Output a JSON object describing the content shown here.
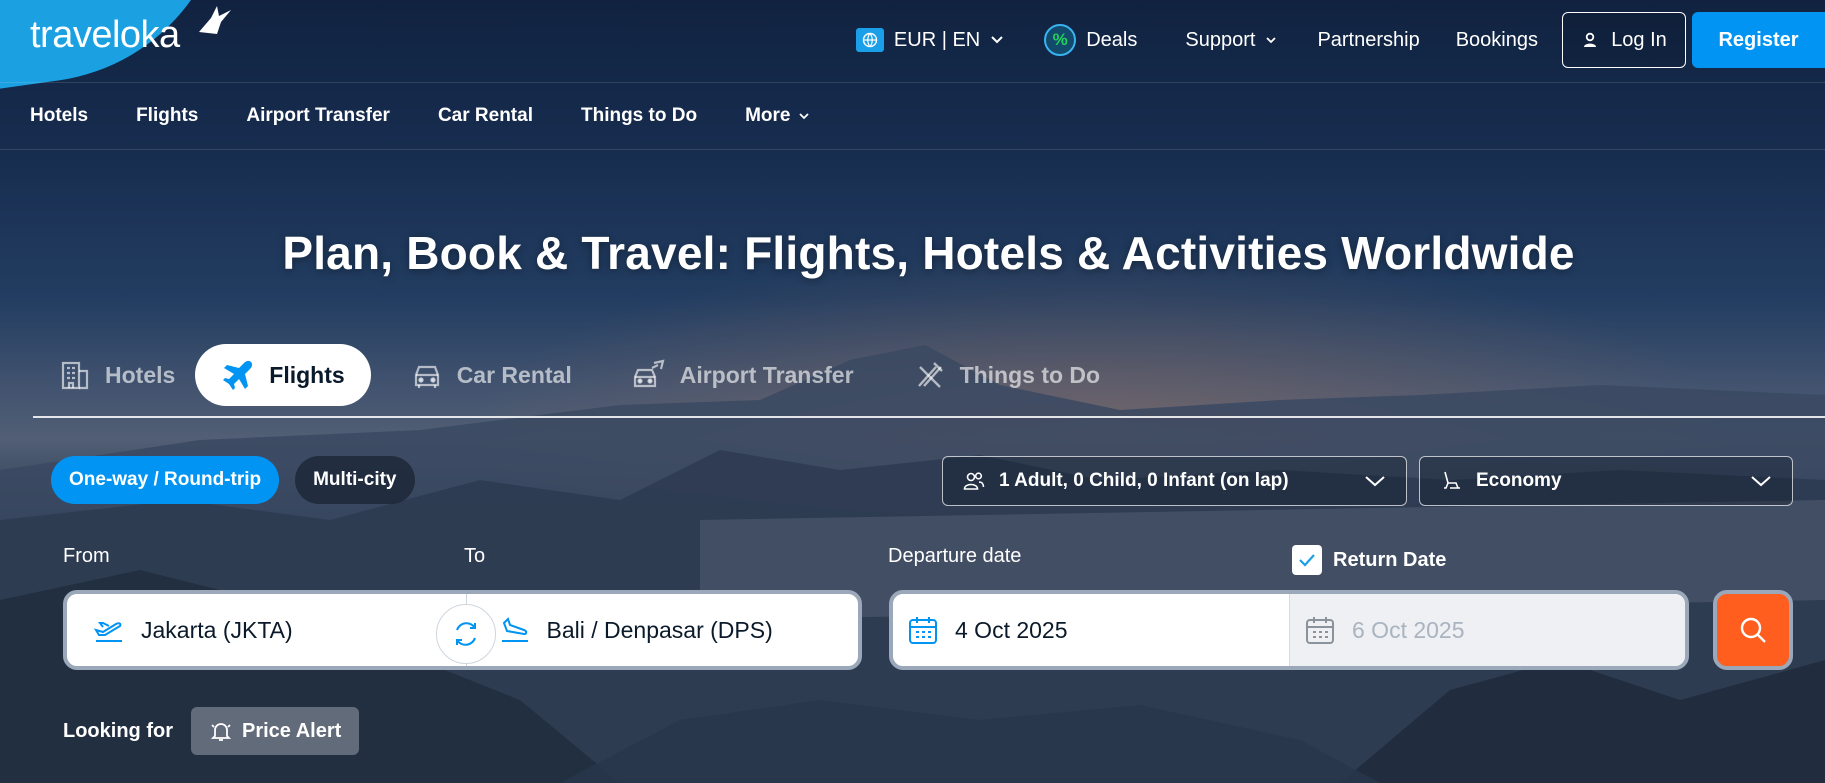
{
  "brand": {
    "name": "traveloka"
  },
  "top_nav": {
    "currency_lang": "EUR | EN",
    "deals": "Deals",
    "deals_badge": "%",
    "support": "Support",
    "partnership": "Partnership",
    "bookings": "Bookings",
    "login": "Log In",
    "register": "Register"
  },
  "second_nav": {
    "items": [
      "Hotels",
      "Flights",
      "Airport Transfer",
      "Car Rental",
      "Things to Do"
    ],
    "more": "More"
  },
  "hero": {
    "title": "Plan, Book & Travel: Flights, Hotels & Activities Worldwide"
  },
  "product_tabs": [
    {
      "label": "Hotels",
      "icon": "hotel-icon",
      "active": false
    },
    {
      "label": "Flights",
      "icon": "airplane-icon",
      "active": true
    },
    {
      "label": "Car Rental",
      "icon": "car-icon",
      "active": false
    },
    {
      "label": "Airport Transfer",
      "icon": "airport-transfer-icon",
      "active": false
    },
    {
      "label": "Things to Do",
      "icon": "things-to-do-icon",
      "active": false
    }
  ],
  "trip_type": {
    "oneway_roundtrip": "One-way / Round-trip",
    "multicity": "Multi-city"
  },
  "passengers": "1 Adult, 0 Child, 0 Infant (on lap)",
  "cabin_class": "Economy",
  "form": {
    "from_label": "From",
    "to_label": "To",
    "departure_label": "Departure date",
    "return_label": "Return Date",
    "return_checked": true,
    "from_value": "Jakarta (JKTA)",
    "to_value": "Bali / Denpasar (DPS)",
    "departure_value": "4 Oct 2025",
    "return_value": "6 Oct 2025"
  },
  "looking_for": {
    "label": "Looking for",
    "price_alert": "Price Alert"
  },
  "colors": {
    "primary_blue": "#0194f3",
    "search_orange": "#ff5e1f",
    "deals_green": "#22d15a"
  }
}
